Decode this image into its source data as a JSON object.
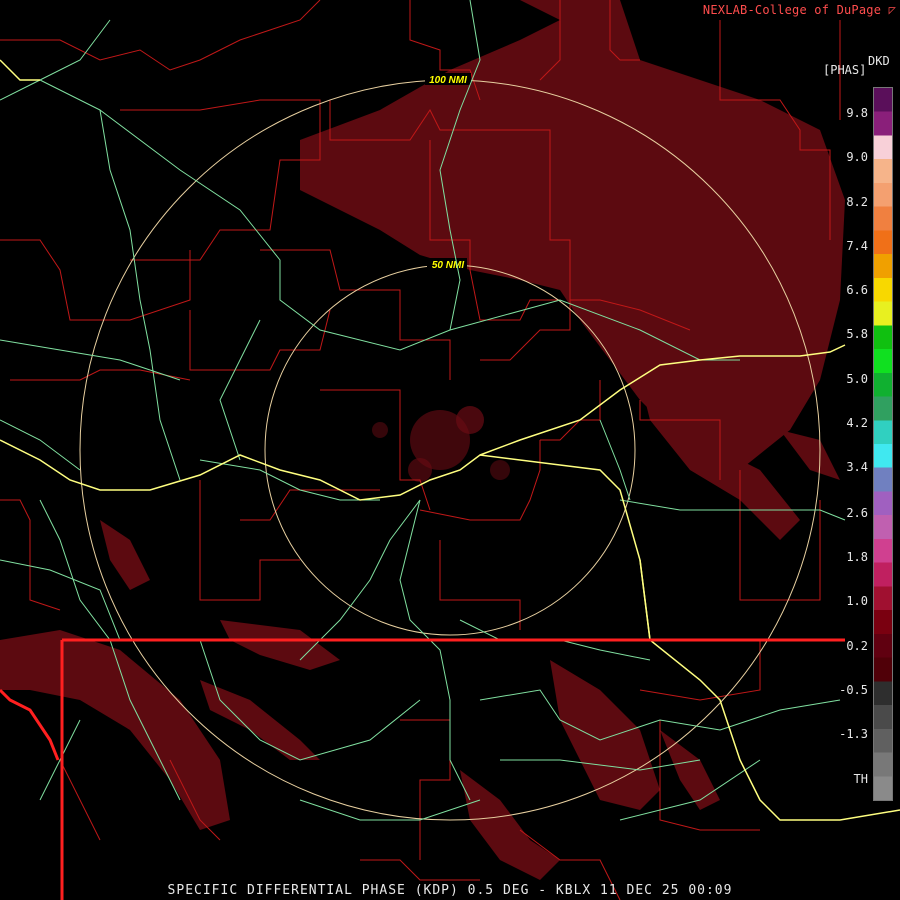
{
  "credit": "NEXLAB-College of DuPage",
  "credit_mark": "◸",
  "product": {
    "code": "DKD",
    "unit": "[PHAS]"
  },
  "ring_labels": [
    "100 NMI",
    "50 NMI"
  ],
  "scale": {
    "labels": [
      "9.8",
      "9.0",
      "8.2",
      "7.4",
      "6.6",
      "5.8",
      "5.0",
      "4.2",
      "3.4",
      "2.6",
      "1.8",
      "1.0",
      "0.2",
      "-0.5",
      "-1.3",
      "TH"
    ],
    "colors": [
      "#5a0f5a",
      "#8a1f7a",
      "#f8d0d8",
      "#f6b48a",
      "#f4a070",
      "#f08040",
      "#f07018",
      "#f0a000",
      "#f8d800",
      "#e8f020",
      "#10c010",
      "#10e020",
      "#10b030",
      "#30a060",
      "#30d0c0",
      "#40e8f0",
      "#7080c0",
      "#a060c0",
      "#c060b0",
      "#d04090",
      "#c02060",
      "#a01030",
      "#7a0010",
      "#600010",
      "#500008",
      "#2e2e2e",
      "#4a4a4a",
      "#606060",
      "#787878",
      "#8a8a8a"
    ],
    "colors_note": "colorbar stops top to bottom"
  },
  "legend_colors": {
    "state_borders": "#ff2020",
    "county_borders": "#c01818",
    "highways": "#ffff80",
    "roads": "#80e0a0",
    "range_rings": "#e8d0a0",
    "precip": "#5c0a10"
  },
  "footer": "SPECIFIC DIFFERENTIAL PHASE (KDP) 0.5 DEG - KBLX 11 DEC 25 00:09"
}
